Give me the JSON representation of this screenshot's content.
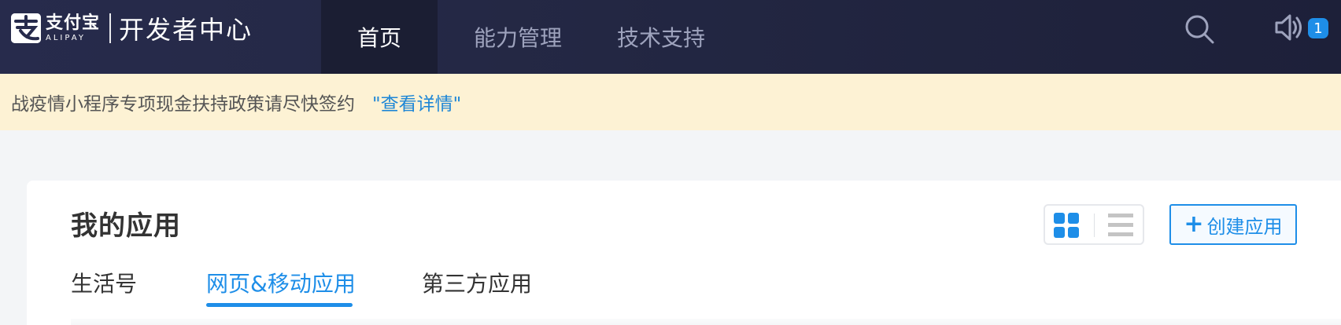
{
  "header": {
    "logo_cn": "支付宝",
    "logo_en": "ALIPAY",
    "title": "开发者中心",
    "nav": [
      {
        "label": "首页",
        "active": true
      },
      {
        "label": "能力管理",
        "active": false
      },
      {
        "label": "技术支持",
        "active": false
      }
    ],
    "search_icon": "search-icon",
    "sound_icon": "speaker-icon",
    "notification_count": "1"
  },
  "notice": {
    "text": "战疫情小程序专项现金扶持政策请尽快签约",
    "link": "\"查看详情\""
  },
  "apps": {
    "title": "我的应用",
    "view_modes": [
      "grid-view-icon",
      "list-view-icon"
    ],
    "active_view": "grid",
    "create_label": "创建应用",
    "tabs": [
      {
        "label": "生活号",
        "active": false
      },
      {
        "label": "网页&移动应用",
        "active": true
      },
      {
        "label": "第三方应用",
        "active": false
      }
    ]
  },
  "colors": {
    "accent": "#1e8ee8",
    "nav_bg": "#232743",
    "notice_bg": "#fdf2d4"
  }
}
